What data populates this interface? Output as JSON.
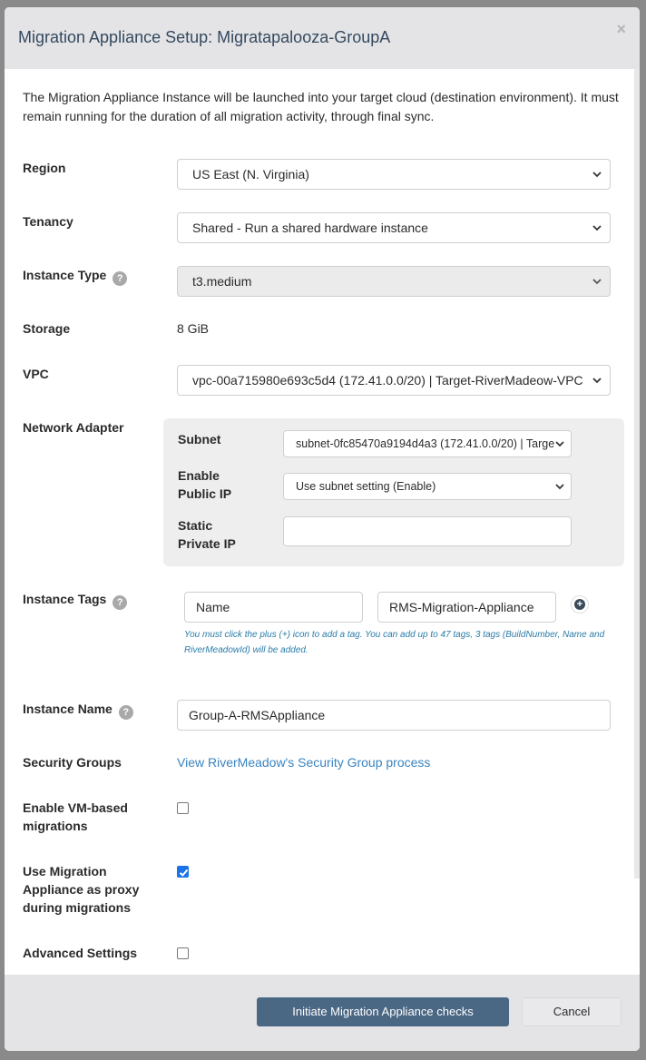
{
  "modal": {
    "title": "Migration Appliance Setup: Migratapalooza-GroupA",
    "close_glyph": "×",
    "intro": "The Migration Appliance Instance will be launched into your target cloud (destination environment). It must remain running for the duration of all migration activity, through final sync."
  },
  "fields": {
    "region_label": "Region",
    "region_value": "US East (N. Virginia)",
    "tenancy_label": "Tenancy",
    "tenancy_value": "Shared - Run a shared hardware instance",
    "instance_type_label": "Instance Type",
    "instance_type_value": "t3.medium",
    "storage_label": "Storage",
    "storage_value": "8 GiB",
    "vpc_label": "VPC",
    "vpc_value": "vpc-00a715980e693c5d4 (172.41.0.0/20) | Target-RiverMadeow-VPC",
    "network_adapter_label": "Network Adapter",
    "subnet_label": "Subnet",
    "subnet_value": "subnet-0fc85470a9194d4a3 (172.41.0.0/20) | Targe",
    "public_ip_label_1": "Enable",
    "public_ip_label_2": "Public IP",
    "public_ip_value": "Use subnet setting (Enable)",
    "static_ip_label_1": "Static",
    "static_ip_label_2": "Private IP",
    "static_ip_value": "",
    "instance_tags_label": "Instance Tags",
    "tag_key_value": "Name",
    "tag_value_value": "RMS-Migration-Appliance",
    "tag_note": "You must click the plus (+) icon to add a tag. You can add up to 47 tags, 3 tags (BuildNumber, Name and RiverMeadowId) will be added.",
    "instance_name_label": "Instance Name",
    "instance_name_value": "Group-A-RMSAppliance",
    "security_groups_label": "Security Groups",
    "security_groups_link": "View RiverMeadow's Security Group process",
    "vm_migrations_label_1": "Enable VM-based",
    "vm_migrations_label_2": "migrations",
    "vm_migrations_checked": false,
    "proxy_label_1": "Use Migration",
    "proxy_label_2": "Appliance as proxy",
    "proxy_label_3": "during migrations",
    "proxy_checked": true,
    "advanced_label": "Advanced Settings",
    "advanced_checked": false
  },
  "footer": {
    "primary_label": "Initiate Migration Appliance checks",
    "cancel_label": "Cancel"
  },
  "icons": {
    "help": "question-circle-icon",
    "plus": "plus-circle-icon",
    "chevron": "chevron-down-icon",
    "check": "checkmark-icon"
  },
  "colors": {
    "primary_button": "#4a6784",
    "link": "#3a84c0",
    "note": "#2a7ca8",
    "header_bg": "#e4e4e7"
  }
}
